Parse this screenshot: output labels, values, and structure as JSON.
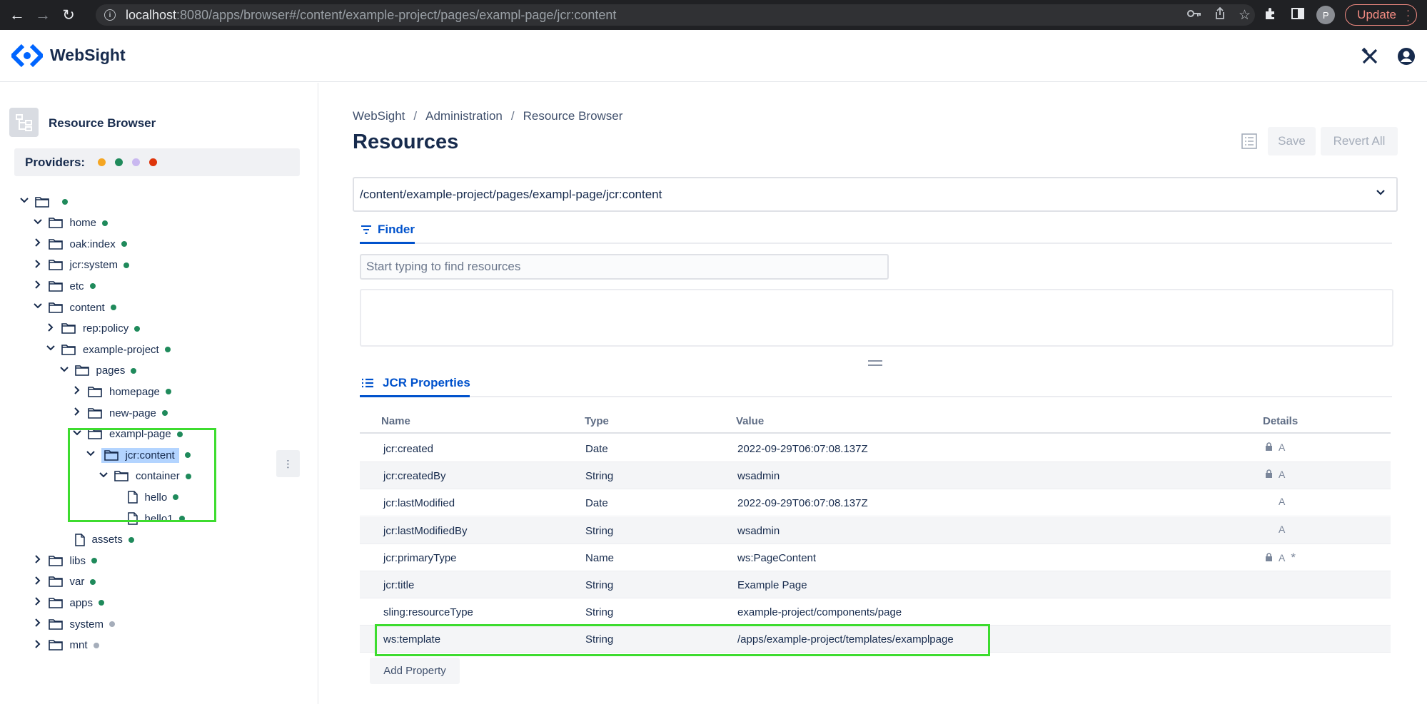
{
  "browser": {
    "url_host": "localhost",
    "url_rest": ":8080/apps/browser#/content/example-project/pages/exampl-page/jcr:content",
    "profile_initial": "P",
    "update_label": "Update"
  },
  "app": {
    "brand": "WebSight"
  },
  "sidebar": {
    "title": "Resource Browser",
    "providers_label": "Providers:",
    "provider_colors": [
      "#f5a623",
      "#1f8a5b",
      "#c9b8f0",
      "#de350b"
    ],
    "tree": [
      {
        "label": "",
        "chevron": "down",
        "kind": "folder",
        "status": "green"
      },
      {
        "label": "home",
        "chevron": "down",
        "kind": "folder",
        "status": "green"
      },
      {
        "label": "oak:index",
        "chevron": "right",
        "kind": "folder",
        "status": "green"
      },
      {
        "label": "jcr:system",
        "chevron": "right",
        "kind": "folder",
        "status": "green"
      },
      {
        "label": "etc",
        "chevron": "right",
        "kind": "folder",
        "status": "green"
      },
      {
        "label": "content",
        "chevron": "down",
        "kind": "folder",
        "status": "green"
      },
      {
        "label": "rep:policy",
        "chevron": "right",
        "kind": "folder",
        "status": "green"
      },
      {
        "label": "example-project",
        "chevron": "down",
        "kind": "folder",
        "status": "green"
      },
      {
        "label": "pages",
        "chevron": "down",
        "kind": "folder",
        "status": "green"
      },
      {
        "label": "homepage",
        "chevron": "right",
        "kind": "folder",
        "status": "green"
      },
      {
        "label": "new-page",
        "chevron": "right",
        "kind": "folder",
        "status": "green"
      },
      {
        "label": "exampl-page",
        "chevron": "down",
        "kind": "folder",
        "status": "green"
      },
      {
        "label": "jcr:content",
        "chevron": "down",
        "kind": "folder",
        "status": "green",
        "selected": true
      },
      {
        "label": "container",
        "chevron": "down",
        "kind": "folder",
        "status": "green"
      },
      {
        "label": "hello",
        "chevron": "",
        "kind": "file",
        "status": "green"
      },
      {
        "label": "hello1",
        "chevron": "",
        "kind": "file",
        "status": "green"
      },
      {
        "label": "assets",
        "chevron": "",
        "kind": "file",
        "status": "green"
      },
      {
        "label": "libs",
        "chevron": "right",
        "kind": "folder",
        "status": "green"
      },
      {
        "label": "var",
        "chevron": "right",
        "kind": "folder",
        "status": "green"
      },
      {
        "label": "apps",
        "chevron": "right",
        "kind": "folder",
        "status": "green"
      },
      {
        "label": "system",
        "chevron": "right",
        "kind": "folder",
        "status": "grey"
      },
      {
        "label": "mnt",
        "chevron": "right",
        "kind": "folder",
        "status": "grey"
      }
    ]
  },
  "main": {
    "breadcrumb": [
      "WebSight",
      "Administration",
      "Resource Browser"
    ],
    "title": "Resources",
    "save_label": "Save",
    "revert_label": "Revert All",
    "path_value": "/content/example-project/pages/exampl-page/jcr:content",
    "finder_tab": "Finder",
    "finder_placeholder": "Start typing to find resources",
    "jcr_tab": "JCR Properties",
    "columns": [
      "Name",
      "Type",
      "Value",
      "Details"
    ],
    "rows": [
      {
        "name": "jcr:created",
        "type": "Date",
        "value": "2022-09-29T06:07:08.137Z",
        "lock": true,
        "a": true,
        "star": false
      },
      {
        "name": "jcr:createdBy",
        "type": "String",
        "value": "wsadmin",
        "lock": true,
        "a": true,
        "star": false
      },
      {
        "name": "jcr:lastModified",
        "type": "Date",
        "value": "2022-09-29T06:07:08.137Z",
        "lock": false,
        "a": true,
        "star": false
      },
      {
        "name": "jcr:lastModifiedBy",
        "type": "String",
        "value": "wsadmin",
        "lock": false,
        "a": true,
        "star": false
      },
      {
        "name": "jcr:primaryType",
        "type": "Name",
        "value": "ws:PageContent",
        "lock": true,
        "a": true,
        "star": true
      },
      {
        "name": "jcr:title",
        "type": "String",
        "value": "Example Page",
        "lock": false,
        "a": false,
        "star": false
      },
      {
        "name": "sling:resourceType",
        "type": "String",
        "value": "example-project/components/page",
        "lock": false,
        "a": false,
        "star": false
      },
      {
        "name": "ws:template",
        "type": "String",
        "value": "/apps/example-project/templates/examplpage",
        "lock": false,
        "a": false,
        "star": false
      }
    ],
    "add_property_label": "Add Property",
    "detail_glyphs": {
      "a": "A",
      "star": "*"
    }
  }
}
